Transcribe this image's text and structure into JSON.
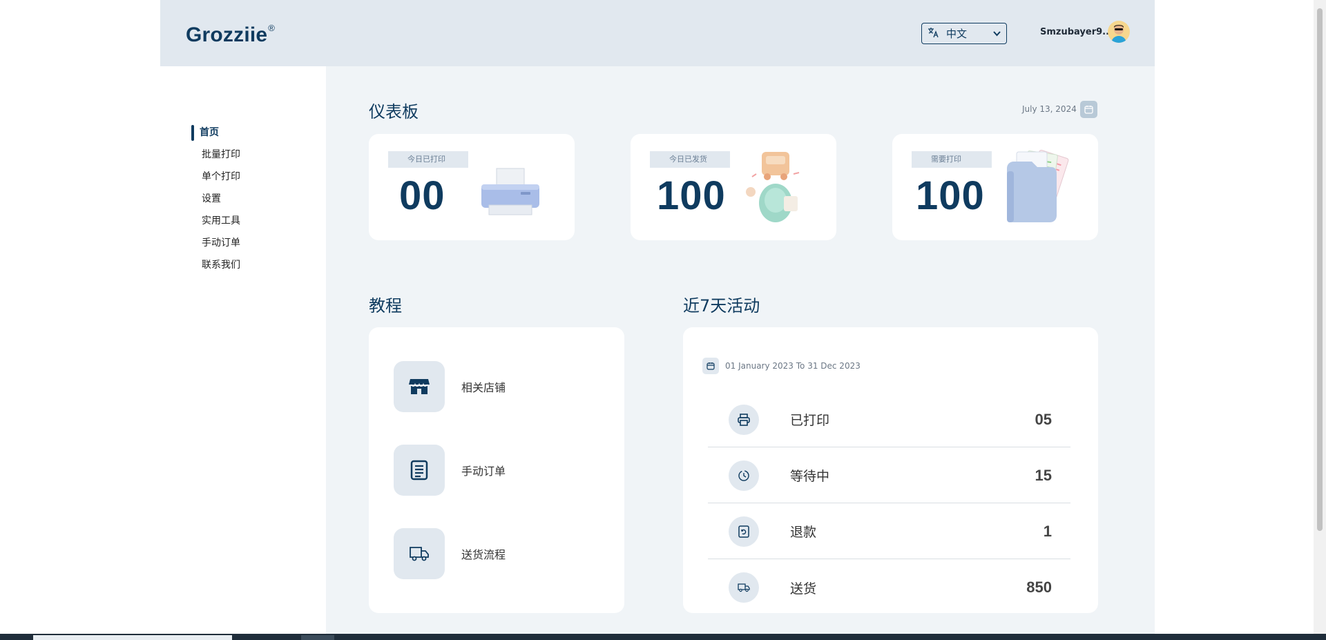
{
  "brand": {
    "name": "Grozziie",
    "mark": "®"
  },
  "header": {
    "language": "中文",
    "user_name": "Smzubayer9..."
  },
  "sidebar": {
    "items": [
      {
        "label": "首页",
        "active": true
      },
      {
        "label": "批量打印"
      },
      {
        "label": "单个打印"
      },
      {
        "label": "设置"
      },
      {
        "label": "实用工具"
      },
      {
        "label": "手动订单"
      },
      {
        "label": "联系我们"
      }
    ]
  },
  "dashboard": {
    "title": "仪表板",
    "date": "July 13, 2024",
    "stats": [
      {
        "label": "今日已打印",
        "value": "00",
        "icon": "printer-illustration"
      },
      {
        "label": "今日已发货",
        "value": "100",
        "icon": "delivery-truck-illustration"
      },
      {
        "label": "需要打印",
        "value": "100",
        "icon": "documents-folder-illustration"
      }
    ]
  },
  "tutorial": {
    "title": "教程",
    "items": [
      {
        "label": "相关店铺",
        "icon": "store-icon"
      },
      {
        "label": "手动订单",
        "icon": "order-list-icon"
      },
      {
        "label": "送货流程",
        "icon": "truck-icon"
      }
    ]
  },
  "activity": {
    "title": "近7天活动",
    "range": "01 January 2023 To 31 Dec 2023",
    "rows": [
      {
        "label": "已打印",
        "value": "05",
        "icon": "printer-icon"
      },
      {
        "label": "等待中",
        "value": "15",
        "icon": "clock-icon"
      },
      {
        "label": "退款",
        "value": "1",
        "icon": "refund-icon"
      },
      {
        "label": "送货",
        "value": "850",
        "icon": "truck-icon"
      }
    ]
  },
  "colors": {
    "brand": "#0f3b5f",
    "panel": "#e1e8ef",
    "page": "#f0f4f7"
  }
}
